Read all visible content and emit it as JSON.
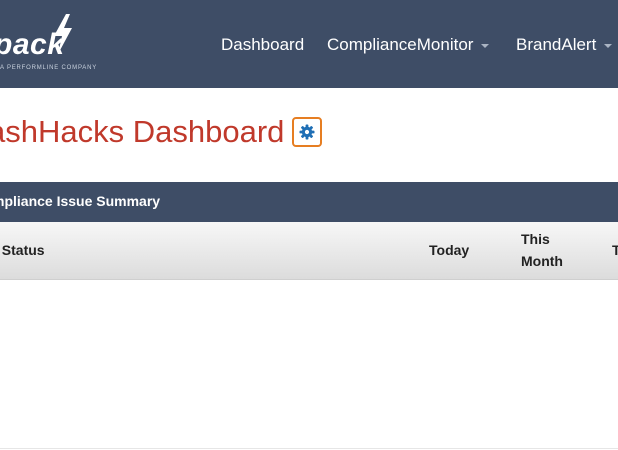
{
  "navbar": {
    "logo": {
      "text": "pack",
      "subtext": "A PERFORMLINE COMPANY"
    },
    "items": [
      {
        "label": "Dashboard",
        "has_caret": false
      },
      {
        "label": "ComplianceMonitor",
        "has_caret": true
      },
      {
        "label": "BrandAlert",
        "has_caret": true
      }
    ]
  },
  "page": {
    "title": "ashHacks Dashboard",
    "settings_icon": "gear-icon"
  },
  "panel": {
    "title": "mpliance Issue Summary",
    "columns": {
      "status": "/ Status",
      "today": "Today",
      "this_month": "This Month",
      "total": "T"
    },
    "rows": []
  },
  "colors": {
    "navbar_bg": "#3e4d66",
    "title_red": "#c0392b",
    "gear_blue": "#1f6fb5",
    "gear_border": "#e67e22"
  }
}
